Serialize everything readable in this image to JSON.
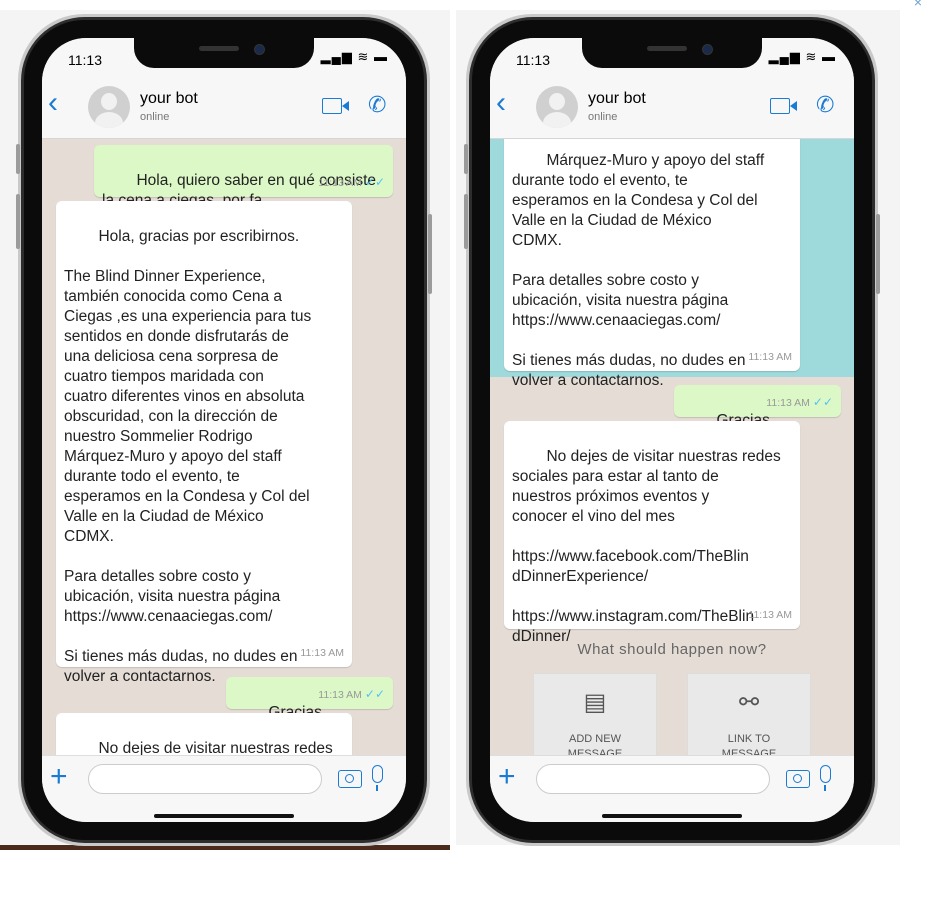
{
  "left_phone": {
    "clock": "11:13",
    "status_icons": "▂▄▆ ≋ ▬",
    "header": {
      "name": "your bot",
      "presence": "online"
    },
    "messages": [
      {
        "dir": "out",
        "text": "Hola, quiero saber en qué consiste\nla cena a ciegas, por fa",
        "time": "11:13 AM",
        "read": "✓✓"
      },
      {
        "dir": "in",
        "text": "Hola, gracias por escribirnos.\n\nThe Blind Dinner Experience,\ntambién conocida como Cena a\nCiegas ,es una experiencia para tus\nsentidos en donde disfrutarás de\nuna deliciosa cena sorpresa de\ncuatro tiempos maridada con\ncuatro diferentes vinos en absoluta\nobscuridad, con la dirección de\nnuestro Sommelier Rodrigo\nMárquez-Muro y apoyo del staff\ndurante todo el evento, te\nesperamos en la Condesa y Col del\nValle en la Ciudad de México\nCDMX.\n\nPara detalles sobre costo y\nubicación, visita nuestra página\nhttps://www.cenaaciegas.com/\n\nSi tienes más dudas, no dudes en\nvolver a contactarnos.",
        "time": "11:13 AM"
      },
      {
        "dir": "out",
        "text": "Gracias",
        "time": "11:13 AM",
        "read": "✓✓"
      },
      {
        "dir": "in",
        "text": "No dejes de visitar nuestras redes\nsociales para estar al tanto de\nnuestros próximos eventos y",
        "time": ""
      }
    ]
  },
  "right_phone": {
    "clock": "11:13",
    "status_icons": "▂▄▆ ≋ ▬",
    "header": {
      "name": "your bot",
      "presence": "online"
    },
    "messages": [
      {
        "dir": "in",
        "text": "Márquez-Muro y apoyo del staff\ndurante todo el evento, te\nesperamos en la Condesa y Col del\nValle en la Ciudad de México\nCDMX.\n\nPara detalles sobre costo y\nubicación, visita nuestra página\nhttps://www.cenaaciegas.com/\n\nSi tienes más dudas, no dudes en\nvolver a contactarnos.",
        "time": "11:13 AM"
      },
      {
        "dir": "out",
        "text": "Gracias",
        "time": "11:13 AM",
        "read": "✓✓"
      },
      {
        "dir": "in",
        "text": "No dejes de visitar nuestras redes\nsociales para estar al tanto de\nnuestros próximos eventos y\nconocer el vino del mes\n\nhttps://www.facebook.com/TheBlin\ndDinnerExperience/\n\nhttps://www.instagram.com/TheBlin\ndDinner/",
        "time": "11:13 AM"
      }
    ],
    "prompt": "What should happen now?",
    "actions": [
      {
        "label": "ADD NEW\nMESSAGE",
        "icon": "message-icon"
      },
      {
        "label": "LINK TO\nMESSAGE",
        "icon": "link-icon"
      }
    ]
  },
  "close_glyph": "×",
  "colors": {
    "accent": "#1a7bd5",
    "outgoing": "#dcf8c6",
    "incoming": "#ffffff",
    "highlight": "#9ed9dc",
    "chat_bg": "#e5ddd5"
  }
}
